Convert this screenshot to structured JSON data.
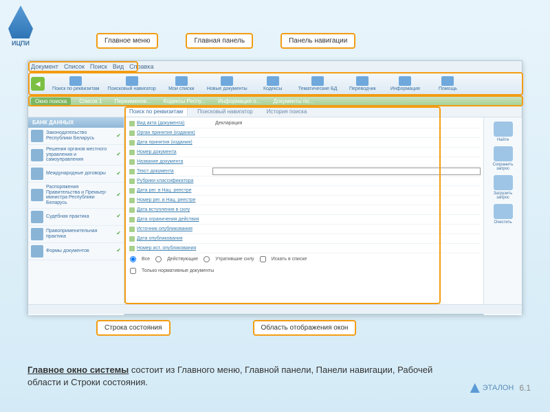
{
  "logo": "ИЦПИ",
  "callouts": {
    "top": [
      "Главное меню",
      "Главная панель",
      "Панель навигации"
    ],
    "bottom": [
      "Строка состояния",
      "Область отображения окон"
    ]
  },
  "menubar": [
    "Документ",
    "Список",
    "Поиск",
    "Вид",
    "Справка"
  ],
  "toolbar": [
    "Поиск по реквизитам",
    "Поисковый навигатор",
    "Мои списки",
    "Новые документы",
    "Кодексы",
    "Тематические БД",
    "Переводчик",
    "Информация",
    "Помощь"
  ],
  "nav_tabs": [
    "Окно поиска",
    "Список 1",
    "Переименов...",
    "Кодексы Респу...",
    "Информация о...",
    "Документы по..."
  ],
  "sub_tabs": [
    "Поиск по реквизитам",
    "Поисковый навигатор",
    "История поиска"
  ],
  "sidebar": {
    "header": "БАНК ДАННЫХ",
    "items": [
      "Законодательство Республики Беларусь",
      "Решения органов местного управления и самоуправления",
      "Международные договоры",
      "Распоряжения Правительства и Премьер-министра Республики Беларусь",
      "Судебная практика",
      "Правоприменительная практика",
      "Формы документов"
    ]
  },
  "form": {
    "rows": [
      {
        "label": "Вид акта (документа)",
        "value": "Декларация"
      },
      {
        "label": "Орган принятия (издания)",
        "value": ""
      },
      {
        "label": "Дата принятия (издания)",
        "value": ""
      },
      {
        "label": "Номер документа",
        "value": ""
      },
      {
        "label": "Название документа",
        "value": ""
      },
      {
        "label": "Текст документа",
        "value": "",
        "input": true
      },
      {
        "label": "Рубрики классификатора",
        "value": ""
      },
      {
        "label": "Дата рег. в Нац. реестре",
        "value": ""
      },
      {
        "label": "Номер рег. в Нац. реестре",
        "value": ""
      },
      {
        "label": "Дата вступления в силу",
        "value": ""
      },
      {
        "label": "Дата ограничения действия",
        "value": ""
      },
      {
        "label": "Источник опубликования",
        "value": ""
      },
      {
        "label": "Дата опубликования",
        "value": ""
      },
      {
        "label": "Номер ист. опубликования",
        "value": ""
      }
    ],
    "options": [
      "Все",
      "Действующие",
      "Утратившие силу",
      "Искать в списке"
    ],
    "option2": "Только нормативные документы"
  },
  "right_panel": [
    "Найти",
    "Сохранить запрос",
    "Загрузить запрос",
    "Очистить"
  ],
  "description": {
    "u": "Главное окно системы",
    "rest": " состоит из Главного меню, Главной панели, Панели навигации, Рабочей области и Строки состояния."
  },
  "footer": {
    "name": "ЭТАЛОН",
    "ver": "6.1"
  }
}
